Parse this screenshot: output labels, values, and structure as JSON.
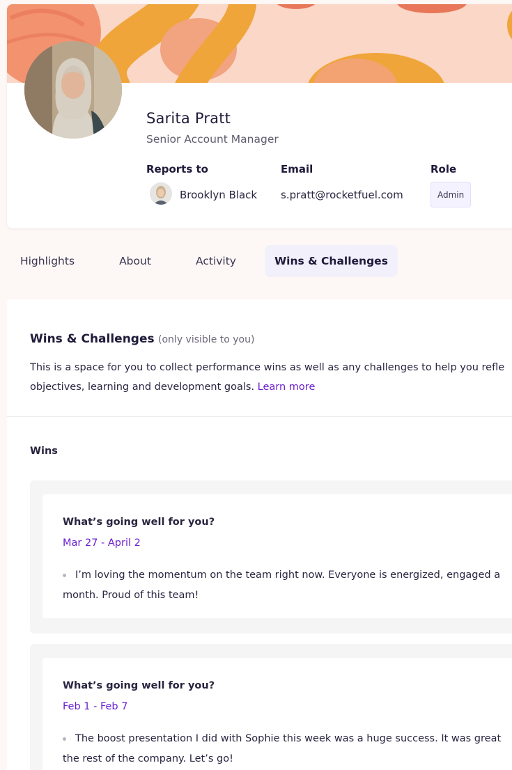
{
  "profile": {
    "name": "Sarita Pratt",
    "title": "Senior Account Manager",
    "reports_to_label": "Reports to",
    "reports_to_name": "Brooklyn Black",
    "email_label": "Email",
    "email": "s.pratt@rocketfuel.com",
    "role_label": "Role",
    "role": "Admin"
  },
  "tabs": [
    {
      "label": "Highlights",
      "active": false
    },
    {
      "label": "About",
      "active": false
    },
    {
      "label": "Activity",
      "active": false
    },
    {
      "label": "Wins & Challenges",
      "active": true
    }
  ],
  "section": {
    "title": "Wins & Challenges",
    "visibility_note": "(only visible to you)",
    "description_line1": "This is a space for you to collect performance wins as well as any challenges to help you refle",
    "description_line2": "objectives, learning and development goals. ",
    "learn_more": "Learn more",
    "wins_heading": "Wins"
  },
  "wins": [
    {
      "question": "What’s going well for you?",
      "date_range": "Mar 27 - April 2",
      "line1": "I’m loving the momentum on the team right now. Everyone is energized, engaged a",
      "line2": "month. Proud of this team!"
    },
    {
      "question": "What’s going well for you?",
      "date_range": "Feb 1 - Feb 7",
      "line1": "The boost presentation I did with Sophie this week was a huge success. It was great",
      "line2": "the rest of the company. Let’s go!"
    }
  ],
  "colors": {
    "accent": "#6a1fd0",
    "banner_bg": "#fbd7c7",
    "banner_orange": "#f0a53a",
    "banner_coral": "#f08a6a",
    "active_tab_bg": "#f2f0fb"
  },
  "icons": [
    "profile-photo",
    "manager-photo",
    "bullet-dot"
  ]
}
